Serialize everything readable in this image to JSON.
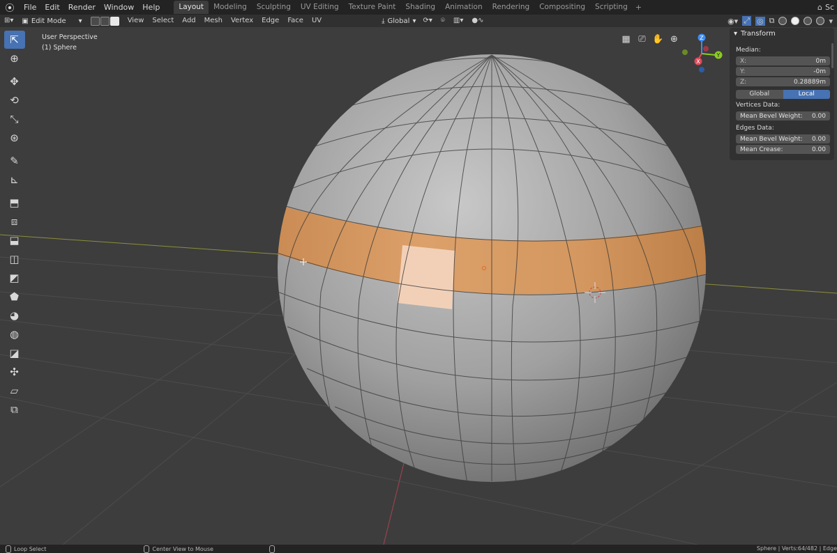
{
  "topbar": {
    "menus": [
      "File",
      "Edit",
      "Render",
      "Window",
      "Help"
    ],
    "workspaces": [
      "Layout",
      "Modeling",
      "Sculpting",
      "UV Editing",
      "Texture Paint",
      "Shading",
      "Animation",
      "Rendering",
      "Compositing",
      "Scripting"
    ],
    "add_tab": "+",
    "scene_partial": "Sc"
  },
  "header": {
    "mode": "Edit Mode",
    "menus": [
      "View",
      "Select",
      "Add",
      "Mesh",
      "Vertex",
      "Edge",
      "Face",
      "UV"
    ],
    "orientation": "Global"
  },
  "viewport": {
    "perspective": "User Perspective",
    "object": "(1) Sphere"
  },
  "gizmo": {
    "x": "X",
    "y": "Y",
    "z": "Z"
  },
  "panel": {
    "title": "Transform",
    "median_label": "Median:",
    "x_label": "X:",
    "x_value": "0m",
    "y_label": "Y:",
    "y_value": "-0m",
    "z_label": "Z:",
    "z_value": "0.28889m",
    "global_label": "Global",
    "local_label": "Local",
    "vertices_label": "Vertices Data:",
    "vertex_bevel_label": "Mean Bevel Weight:",
    "vertex_bevel_value": "0.00",
    "edges_label": "Edges Data:",
    "edge_bevel_label": "Mean Bevel Weight:",
    "edge_bevel_value": "0.00",
    "crease_label": "Mean Crease:",
    "crease_value": "0.00"
  },
  "status": {
    "left": "Loop Select",
    "middle": "Center View to Mouse",
    "right": "Sphere | Verts:64/482 | Edge"
  },
  "colors": {
    "selection": "#e8a35d",
    "active_face": "#f5d3bd",
    "accent": "#4772b3",
    "x_axis": "#e04a5a",
    "y_axis": "#8ccd1f",
    "z_axis": "#3c8cf0"
  }
}
